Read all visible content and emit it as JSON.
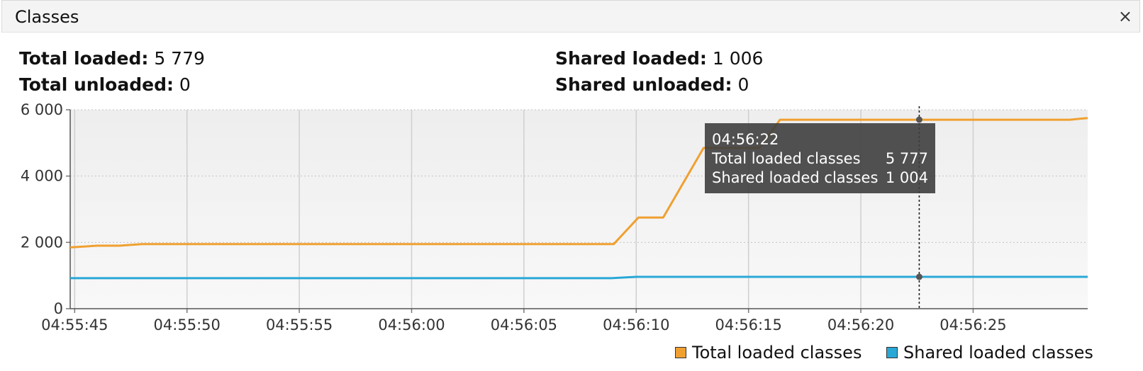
{
  "window": {
    "title": "Classes",
    "close_label": "×"
  },
  "stats": {
    "total_loaded_label": "Total loaded:",
    "total_loaded_value": "5 779",
    "total_unloaded_label": "Total unloaded:",
    "total_unloaded_value": "0",
    "shared_loaded_label": "Shared loaded:",
    "shared_loaded_value": "1 006",
    "shared_unloaded_label": "Shared unloaded:",
    "shared_unloaded_value": "0"
  },
  "tooltip": {
    "time": "04:56:22",
    "rows": [
      {
        "label": "Total loaded classes",
        "value": "5 777"
      },
      {
        "label": "Shared loaded classes",
        "value": "1 004"
      }
    ]
  },
  "legend": [
    {
      "label": "Total loaded classes",
      "color": "#f0a030"
    },
    {
      "label": "Shared loaded classes",
      "color": "#29a8d6"
    }
  ],
  "chart_data": {
    "type": "line",
    "title": "",
    "x_tick_labels": [
      "04:55:45",
      "04:55:50",
      "04:55:55",
      "04:56:00",
      "04:56:05",
      "04:56:10",
      "04:56:15",
      "04:56:20",
      "04:56:25"
    ],
    "y_tick_labels": [
      "0",
      "2 000",
      "4 000",
      "6 000"
    ],
    "y_ticks": [
      0,
      2000,
      4000,
      6000
    ],
    "xlim_seconds_after_04_55_45": [
      -0.2,
      45.1
    ],
    "ylim": [
      0,
      6000
    ],
    "grid": true,
    "legend_position": "bottom-right",
    "crosshair_x": 37.6,
    "series": [
      {
        "name": "Total loaded classes",
        "color": "#f0a030",
        "x": [
          -0.2,
          1.0,
          2.0,
          3.0,
          4.0,
          24.0,
          25.1,
          26.2,
          28.0,
          29.0,
          30.5,
          31.4,
          32.4,
          41.2,
          44.3,
          45.1
        ],
        "y": [
          1850,
          1900,
          1900,
          1950,
          1950,
          1950,
          2750,
          2750,
          4850,
          4850,
          4850,
          5700,
          5700,
          5700,
          5700,
          5750
        ]
      },
      {
        "name": "Shared loaded classes",
        "color": "#29a8d6",
        "x": [
          -0.2,
          23.9,
          25.0,
          45.1
        ],
        "y": [
          920,
          920,
          960,
          960
        ]
      }
    ]
  }
}
